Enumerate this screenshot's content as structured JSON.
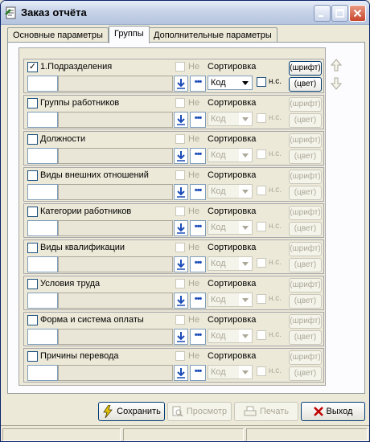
{
  "window": {
    "title": "Заказ отчёта"
  },
  "tabs": [
    {
      "label": "Основные параметры",
      "active": false
    },
    {
      "label": "Группы",
      "active": true
    },
    {
      "label": "Дополнительные параметры",
      "active": false
    }
  ],
  "groups": [
    {
      "label": "1.Подразделения",
      "checked": true,
      "enabled": true,
      "ne_label": "Не",
      "sort_label": "Сортировка",
      "sort_value": "Код",
      "nc_label": "н.с.",
      "font_label": "(шрифт)",
      "color_label": "(цвет)"
    },
    {
      "label": "Группы работников",
      "checked": false,
      "enabled": false,
      "ne_label": "Не",
      "sort_label": "Сортировка",
      "sort_value": "Код",
      "nc_label": "н.с.",
      "font_label": "(шрифт)",
      "color_label": "(цвет)"
    },
    {
      "label": "Должности",
      "checked": false,
      "enabled": false,
      "ne_label": "Не",
      "sort_label": "Сортировка",
      "sort_value": "Код",
      "nc_label": "н.с.",
      "font_label": "(шрифт)",
      "color_label": "(цвет)"
    },
    {
      "label": "Виды внешних отношений",
      "checked": false,
      "enabled": false,
      "ne_label": "Не",
      "sort_label": "Сортировка",
      "sort_value": "Код",
      "nc_label": "н.с.",
      "font_label": "(шрифт)",
      "color_label": "(цвет)"
    },
    {
      "label": "Категории работников",
      "checked": false,
      "enabled": false,
      "ne_label": "Не",
      "sort_label": "Сортировка",
      "sort_value": "Код",
      "nc_label": "н.с.",
      "font_label": "(шрифт)",
      "color_label": "(цвет)"
    },
    {
      "label": "Виды квалификации",
      "checked": false,
      "enabled": false,
      "ne_label": "Не",
      "sort_label": "Сортировка",
      "sort_value": "Код",
      "nc_label": "н.с.",
      "font_label": "(шрифт)",
      "color_label": "(цвет)"
    },
    {
      "label": "Условия труда",
      "checked": false,
      "enabled": false,
      "ne_label": "Не",
      "sort_label": "Сортировка",
      "sort_value": "Код",
      "nc_label": "н.с.",
      "font_label": "(шрифт)",
      "color_label": "(цвет)"
    },
    {
      "label": "Форма и система оплаты",
      "checked": false,
      "enabled": false,
      "ne_label": "Не",
      "sort_label": "Сортировка",
      "sort_value": "Код",
      "nc_label": "н.с.",
      "font_label": "(шрифт)",
      "color_label": "(цвет)"
    },
    {
      "label": "Причины перевода",
      "checked": false,
      "enabled": false,
      "ne_label": "Не",
      "sort_label": "Сортировка",
      "sort_value": "Код",
      "nc_label": "н.с.",
      "font_label": "(шрифт)",
      "color_label": "(цвет)"
    }
  ],
  "buttons": {
    "save": "Сохранить",
    "preview": "Просмотр",
    "print": "Печать",
    "exit": "Выход"
  },
  "colors": {
    "window_bg": "#ECE9D8",
    "exit_icon": "#C00000",
    "save_icon": "#E8C800",
    "accent_blue": "#1C4CB8"
  }
}
